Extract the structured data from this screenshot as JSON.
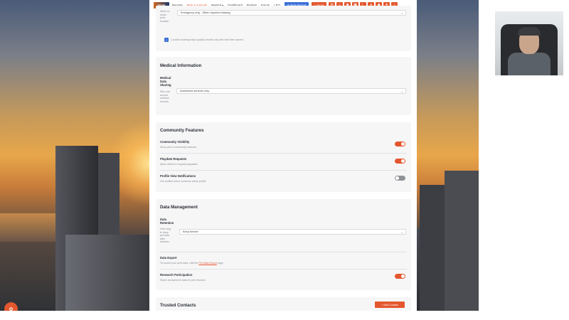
{
  "navbar": {
    "logo_text": "Petsafe",
    "links": [
      "Reports",
      "Pets & Animals",
      "Wanted ▾",
      "Dashboard",
      "Binders",
      "Forum",
      "LSO"
    ],
    "submit_report": "Submit Report",
    "logout": "Logout",
    "icons": [
      "email-icon",
      "home-icon",
      "camera-icon",
      "map-icon",
      "moon-icon",
      "chat-icon",
      "shield-icon",
      "heart-icon",
      "bell-icon"
    ]
  },
  "location_section": {
    "side_label_lines": [
      "When to",
      "share",
      "pet's",
      "location"
    ],
    "select_value": "Emergency only - When reported missing",
    "checkbox_label": "Location sharing helps quickly reunite lost pets with their owners"
  },
  "medical": {
    "title": "Medical Information",
    "label": "Medical Data Sharing",
    "desc_lines": [
      "Who can",
      "access",
      "medical",
      "records"
    ],
    "select_value": "Authorized services only"
  },
  "community": {
    "title": "Community Features",
    "items": [
      {
        "label": "Community Visibility",
        "desc": "Show pet in community features",
        "on": true
      },
      {
        "label": "Playdate Requests",
        "desc": "Allow others to request playdates",
        "on": true
      },
      {
        "label": "Profile View Notifications",
        "desc": "Get notified when someone views profile",
        "on": false
      }
    ]
  },
  "data_mgmt": {
    "title": "Data Management",
    "retention_label": "Data Retention",
    "retention_desc_lines": [
      "How long",
      "to keep",
      "pet data",
      "after",
      "deletion"
    ],
    "retention_value": "Keep forever",
    "export_label": "Data Export",
    "export_desc_prefix": "To export your pet's data, visit the ",
    "export_link": "Pet Data Export",
    "export_desc_suffix": " page",
    "research_label": "Research Participation",
    "research_desc": "Share anonymized data for pet research",
    "research_on": true
  },
  "trusted": {
    "title": "Trusted Contacts",
    "add_button": "+ Add Contact"
  },
  "colors": {
    "accent": "#e4572e",
    "primary": "#3b6fd8",
    "card_bg": "#f6f6f7"
  }
}
